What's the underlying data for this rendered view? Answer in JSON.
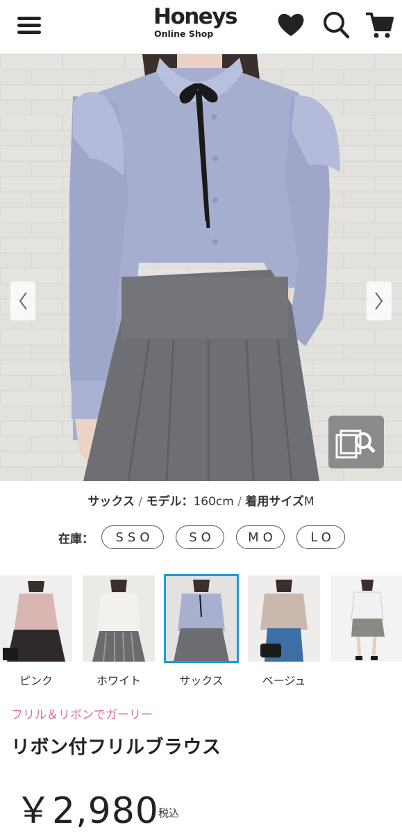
{
  "header": {
    "logo_main": "Honeys",
    "logo_sub": "Online Shop",
    "icons": [
      "menu-icon",
      "heart-icon",
      "search-icon",
      "cart-icon"
    ]
  },
  "product": {
    "color_name": "サックス",
    "sep1": " / ",
    "model_label": "モデル：",
    "model_height": "160cm",
    "sep2": " / ",
    "size_label": "着用サイズ",
    "size_value": "M",
    "stock_label": "在庫：",
    "sizes": [
      "SSO",
      "SO",
      "MO",
      "LO"
    ],
    "catch_copy": "フリル＆リボンでガーリー",
    "name": "リボン付フリルブラウス",
    "price": "￥2,980",
    "tax_label": "税込"
  },
  "colors": [
    {
      "label": "ピンク",
      "top": "#d9b6b2",
      "bottom": "#2e2a2b"
    },
    {
      "label": "ホワイト",
      "top": "#f2f1ee",
      "bottom": "#6b6b6b"
    },
    {
      "label": "サックス",
      "top": "#a9b0cf",
      "bottom": "#6b6d73",
      "selected": true
    },
    {
      "label": "ベージュ",
      "top": "#c9b8ae",
      "bottom": "#3c6fa3"
    },
    {
      "label": "",
      "top": "#f1f1f1",
      "bottom": "#8b8983"
    }
  ],
  "theme": {
    "accent_pink": "#e06a9b",
    "selected_border": "#1d9bd7",
    "blouse_color": "#a6aed0",
    "skirt_color": "#6e6f74"
  }
}
